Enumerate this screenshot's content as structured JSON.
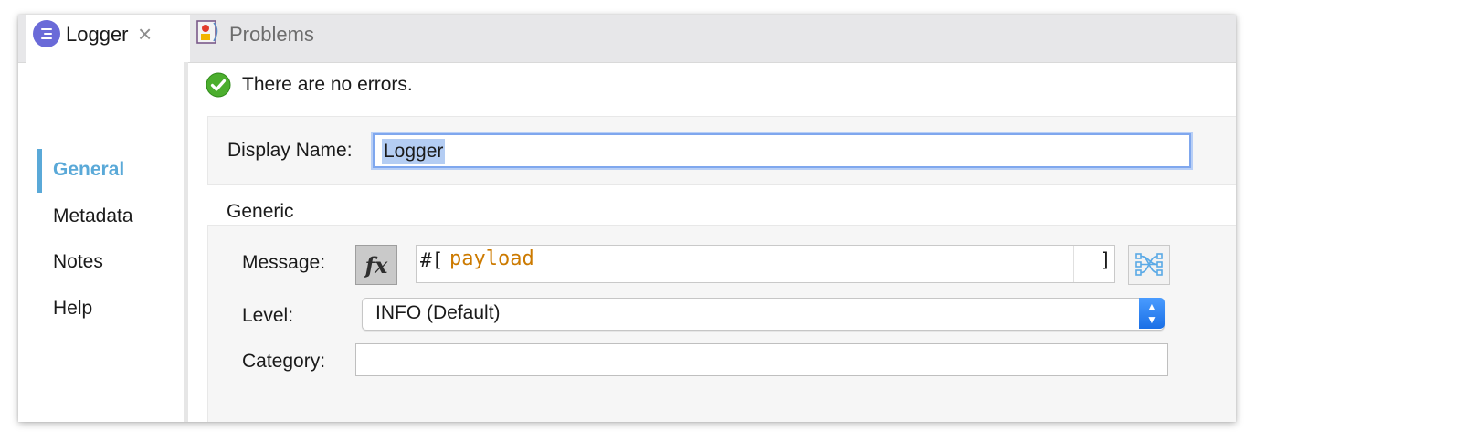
{
  "tabs": [
    {
      "label": "Logger",
      "icon": "logger-icon",
      "active": true
    },
    {
      "label": "Problems",
      "icon": "problems-icon",
      "active": false
    }
  ],
  "sidebar": {
    "items": [
      {
        "label": "General",
        "active": true
      },
      {
        "label": "Metadata",
        "active": false
      },
      {
        "label": "Notes",
        "active": false
      },
      {
        "label": "Help",
        "active": false
      }
    ]
  },
  "status": {
    "text": "There are no errors.",
    "icon": "check-icon"
  },
  "display_name": {
    "label": "Display Name:",
    "value": "Logger"
  },
  "generic": {
    "title": "Generic",
    "message": {
      "label": "Message:",
      "prefix": "#[",
      "expression": "payload",
      "suffix": "]"
    },
    "level": {
      "label": "Level:",
      "value": "INFO (Default)"
    },
    "category": {
      "label": "Category:",
      "value": ""
    }
  },
  "colors": {
    "accent": "#5aa9d8",
    "expression": "#cc7a00",
    "focus": "#7fa7ee"
  }
}
